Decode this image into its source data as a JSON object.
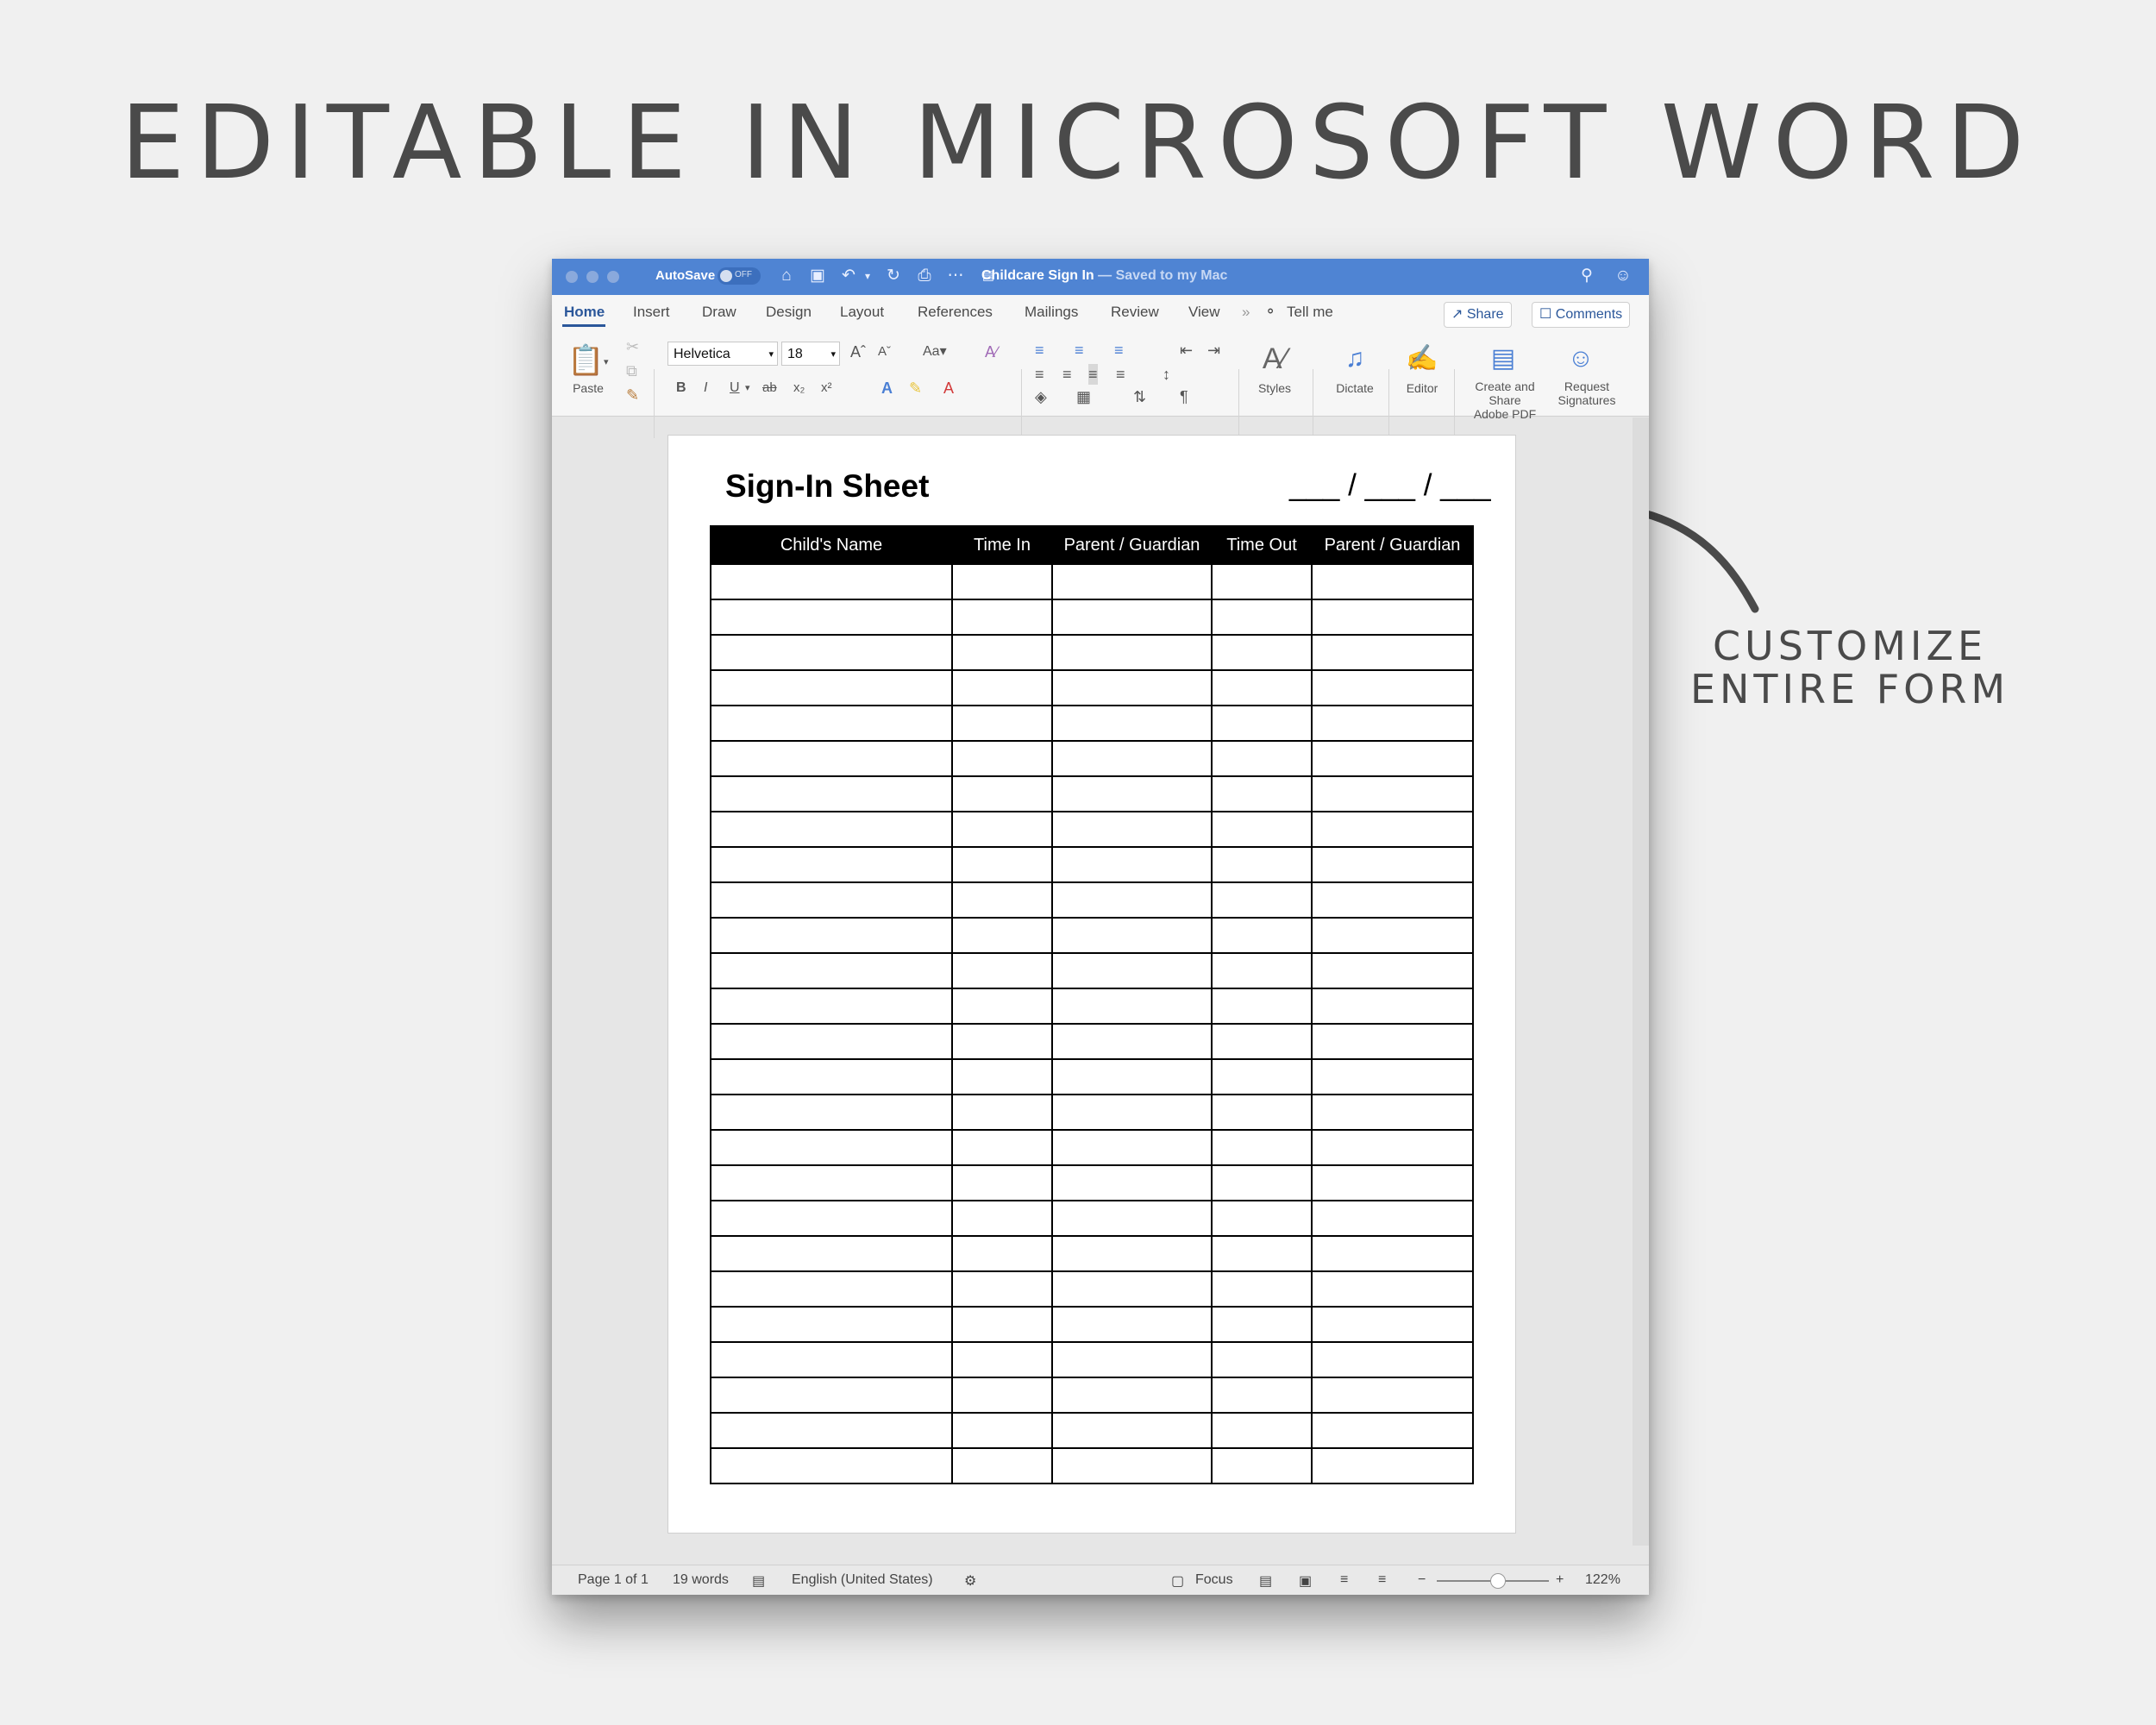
{
  "headline": "EDITABLE IN MICROSOFT WORD",
  "callout": {
    "line1": "CUSTOMIZE",
    "line2": "ENTIRE FORM"
  },
  "titlebar": {
    "autosave": "AutoSave",
    "autosave_state": "OFF",
    "doc_title": "Childcare Sign In",
    "saved_status": " — Saved to my Mac"
  },
  "tabs": [
    "Home",
    "Insert",
    "Draw",
    "Design",
    "Layout",
    "References",
    "Mailings",
    "Review",
    "View"
  ],
  "tell_me": "Tell me",
  "share_label": "Share",
  "comments_label": "Comments",
  "ribbon": {
    "paste": "Paste",
    "font_name": "Helvetica",
    "font_size": "18",
    "styles": "Styles",
    "dictate": "Dictate",
    "editor": "Editor",
    "adobe_line1": "Create and Share",
    "adobe_line2": "Adobe PDF",
    "request_line1": "Request",
    "request_line2": "Signatures"
  },
  "document": {
    "title": "Sign-In Sheet",
    "date_placeholder": "___ / ___ / ___",
    "columns": [
      "Child's Name",
      "Time In",
      "Parent / Guardian",
      "Time Out",
      "Parent / Guardian"
    ],
    "row_count": 26
  },
  "statusbar": {
    "page": "Page 1 of 1",
    "words": "19 words",
    "language": "English (United States)",
    "focus": "Focus",
    "zoom": "122%"
  },
  "colors": {
    "titlebar": "#4f84d3",
    "accent": "#2b579a",
    "background": "#f0f0f0"
  }
}
